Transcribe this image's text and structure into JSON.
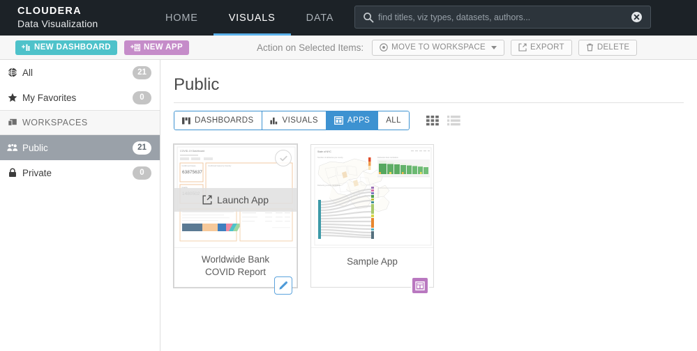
{
  "brand": {
    "name": "CLOUDERA",
    "product": "Data Visualization"
  },
  "nav": {
    "items": [
      {
        "label": "HOME",
        "active": false
      },
      {
        "label": "VISUALS",
        "active": true
      },
      {
        "label": "DATA",
        "active": false
      }
    ]
  },
  "search": {
    "placeholder": "find titles, viz types, datasets, authors...",
    "value": "",
    "icon": "search-icon",
    "clear_icon": "clear-circle-icon"
  },
  "actionbar": {
    "new_dashboard": "NEW DASHBOARD",
    "new_app": "NEW APP",
    "selected_label": "Action on Selected Items:",
    "move_to_workspace": "MOVE TO WORKSPACE",
    "export": "EXPORT",
    "delete": "DELETE"
  },
  "sidebar": {
    "items": [
      {
        "label": "All",
        "count": "21",
        "icon": "globe-icon",
        "type": "filter",
        "selected": false
      },
      {
        "label": "My Favorites",
        "count": "0",
        "icon": "star-icon",
        "type": "filter",
        "selected": false
      },
      {
        "label": "WORKSPACES",
        "count": "",
        "icon": "layers-icon",
        "type": "group",
        "selected": false
      },
      {
        "label": "Public",
        "count": "21",
        "icon": "users-icon",
        "type": "workspace",
        "selected": true
      },
      {
        "label": "Private",
        "count": "0",
        "icon": "lock-icon",
        "type": "workspace",
        "selected": false
      }
    ]
  },
  "main": {
    "title": "Public",
    "tabs": [
      {
        "label": "DASHBOARDS",
        "icon": "dashboard-icon",
        "active": false
      },
      {
        "label": "VISUALS",
        "icon": "bar-chart-icon",
        "active": false
      },
      {
        "label": "APPS",
        "icon": "app-icon",
        "active": true
      },
      {
        "label": "ALL",
        "icon": "",
        "active": false
      }
    ],
    "view": {
      "grid_icon": "grid-view-icon",
      "list_icon": "list-view-icon",
      "active": "grid"
    },
    "cards": [
      {
        "title": "Worldwide Bank COVID Report",
        "hovered": true,
        "overlay_label": "Launch App",
        "overlay_icon": "external-link-icon",
        "corner_icon": "pencil-icon",
        "corner_type": "edit",
        "selectable": true,
        "thumb_title": "COVID-19 Dashboard",
        "thumb_values": [
          "63875637",
          "1480502"
        ],
        "thumb_labels": [
          "Confirmed Cases",
          "Deaths",
          "Confirmed Cases by Country"
        ]
      },
      {
        "title": "Sample App",
        "hovered": false,
        "overlay_label": "",
        "overlay_icon": "",
        "corner_icon": "app-icon",
        "corner_type": "app",
        "selectable": false,
        "thumb_title": "State of NYC",
        "thumb_labels": [
          "Number of deliveries per county",
          "Deliveries best correlation",
          "Delivering county correlation"
        ]
      }
    ]
  },
  "colors": {
    "nav_bg": "#1c2227",
    "accent_blue": "#3d92d1",
    "nav_underline": "#5bb1ea",
    "teal": "#4ec2ca",
    "purple": "#c58cc9",
    "app_badge": "#b978c0",
    "selected_row": "#9aa1a9"
  }
}
